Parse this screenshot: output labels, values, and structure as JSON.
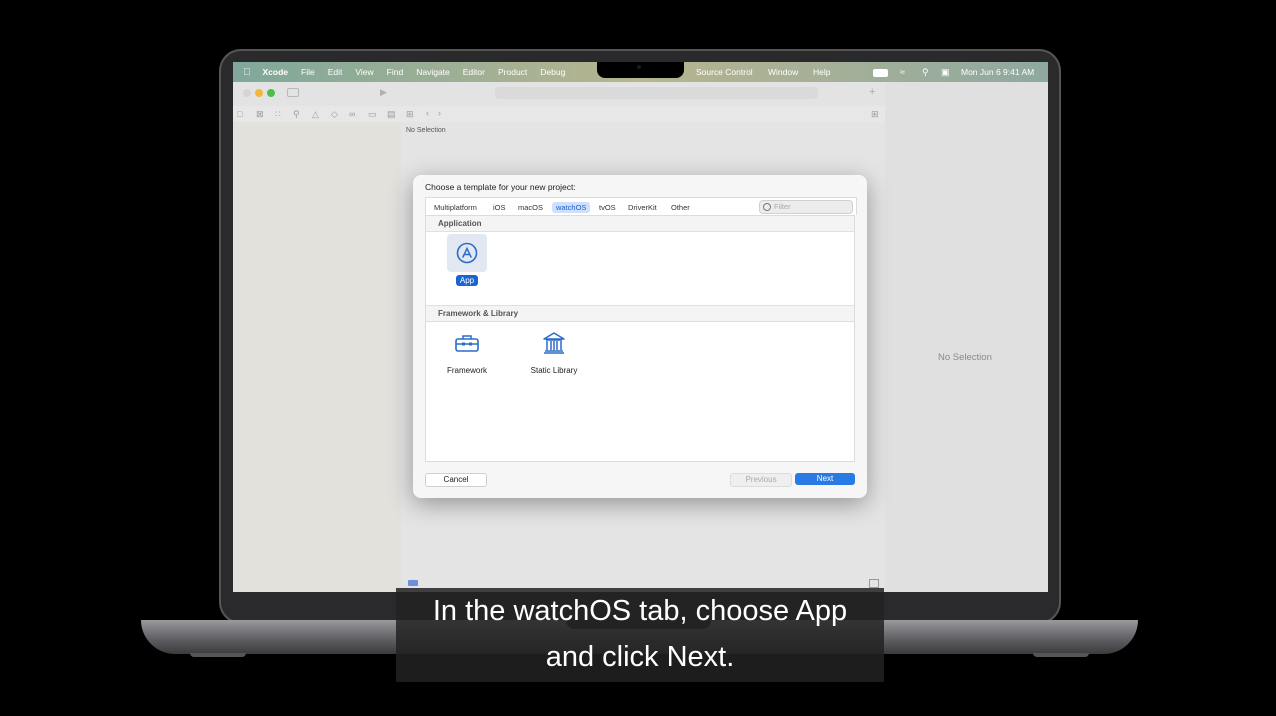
{
  "menubar": {
    "app": "Xcode",
    "items": [
      "File",
      "Edit",
      "View",
      "Find",
      "Navigate",
      "Editor",
      "Product",
      "Debug"
    ],
    "right_items": [
      "Source Control",
      "Window",
      "Help"
    ],
    "datetime": "Mon Jun 6  9:41 AM"
  },
  "editor": {
    "no_selection": "No Selection"
  },
  "inspector": {
    "no_selection": "No Selection"
  },
  "dialog": {
    "title": "Choose a template for your new project:",
    "tabs": [
      "Multiplatform",
      "iOS",
      "macOS",
      "watchOS",
      "tvOS",
      "DriverKit",
      "Other"
    ],
    "selected_tab": "watchOS",
    "filter_placeholder": "Filter",
    "sections": [
      {
        "title": "Application",
        "items": [
          {
            "label": "App",
            "icon": "app-store-icon",
            "selected": true
          }
        ]
      },
      {
        "title": "Framework & Library",
        "items": [
          {
            "label": "Framework",
            "icon": "toolbox-icon"
          },
          {
            "label": "Static Library",
            "icon": "library-icon"
          }
        ]
      }
    ],
    "buttons": {
      "cancel": "Cancel",
      "previous": "Previous",
      "next": "Next"
    }
  },
  "caption": {
    "line1": "In the watchOS tab, choose App",
    "line2": "and click Next."
  },
  "colors": {
    "accent": "#1b64d0",
    "next_button": "#2a7ae6"
  }
}
